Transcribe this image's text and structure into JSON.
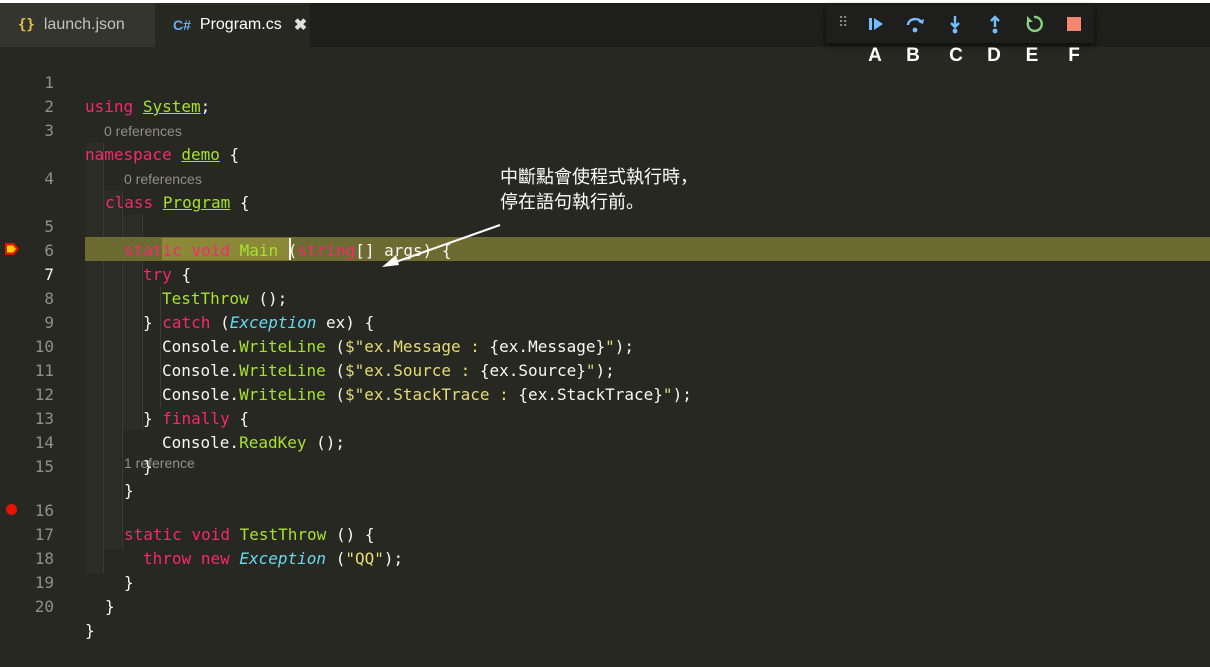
{
  "tabs": [
    {
      "icon": "{}",
      "label": "launch.json",
      "active": false
    },
    {
      "icon": "C#",
      "label": "Program.cs",
      "active": true,
      "close": "✖"
    }
  ],
  "debug_toolbar": {
    "buttons": [
      {
        "name": "continue",
        "letter": "A"
      },
      {
        "name": "step-over",
        "letter": "B"
      },
      {
        "name": "step-into",
        "letter": "C"
      },
      {
        "name": "step-out",
        "letter": "D"
      },
      {
        "name": "restart",
        "letter": "E"
      },
      {
        "name": "stop",
        "letter": "F"
      }
    ]
  },
  "codelens": [
    "0 references",
    "0 references",
    "1 reference"
  ],
  "lines": [
    {
      "n": "1"
    },
    {
      "n": "2"
    },
    {
      "n": "3"
    },
    {
      "n": "4"
    },
    {
      "n": "5"
    },
    {
      "n": "6"
    },
    {
      "n": "7"
    },
    {
      "n": "8"
    },
    {
      "n": "9"
    },
    {
      "n": "10"
    },
    {
      "n": "11"
    },
    {
      "n": "12"
    },
    {
      "n": "13"
    },
    {
      "n": "14"
    },
    {
      "n": "15"
    },
    {
      "n": "16"
    },
    {
      "n": "17"
    },
    {
      "n": "18"
    },
    {
      "n": "19"
    },
    {
      "n": "20"
    }
  ],
  "code": {
    "l1": [
      "using",
      "System",
      ";"
    ],
    "l3": [
      "namespace",
      "demo",
      " {"
    ],
    "l4": [
      "class",
      "Program",
      " {"
    ],
    "l5": [
      "static",
      "void",
      "Main",
      " (",
      "string",
      "[] args) {"
    ],
    "l6": [
      "try",
      " {"
    ],
    "l7": [
      "TestThrow",
      " ();"
    ],
    "l8": [
      "} ",
      "catch",
      " (",
      "Exception",
      " ex) {"
    ],
    "l9": [
      "Console.",
      "WriteLine",
      " (",
      "$\"ex.Message : ",
      "{ex.Message}",
      "\"",
      ");"
    ],
    "l10": [
      "Console.",
      "WriteLine",
      " (",
      "$\"ex.Source : ",
      "{ex.Source}",
      "\"",
      ");"
    ],
    "l11": [
      "Console.",
      "WriteLine",
      " (",
      "$\"ex.StackTrace : ",
      "{ex.StackTrace}",
      "\"",
      ");"
    ],
    "l12": [
      "} ",
      "finally",
      " {"
    ],
    "l13": [
      "Console.",
      "ReadKey",
      " ();"
    ],
    "l14": [
      "}"
    ],
    "l15": [
      "}"
    ],
    "l16": [
      "static",
      "void",
      "TestThrow",
      " () {"
    ],
    "l17": [
      "throw",
      "new",
      "Exception",
      " (",
      "\"QQ\"",
      ");"
    ],
    "l18": [
      "}"
    ],
    "l19": [
      "}"
    ],
    "l20": [
      "}"
    ]
  },
  "annotation": [
    "中斷點會使程式執行時，",
    "停在語句執行前。"
  ],
  "colors": {
    "keyword": "#f92672",
    "type": "#66d9ef",
    "function": "#a6e22e",
    "string": "#e6db74",
    "current_line": "#6e6b32",
    "breakpoint": "#e51400"
  }
}
